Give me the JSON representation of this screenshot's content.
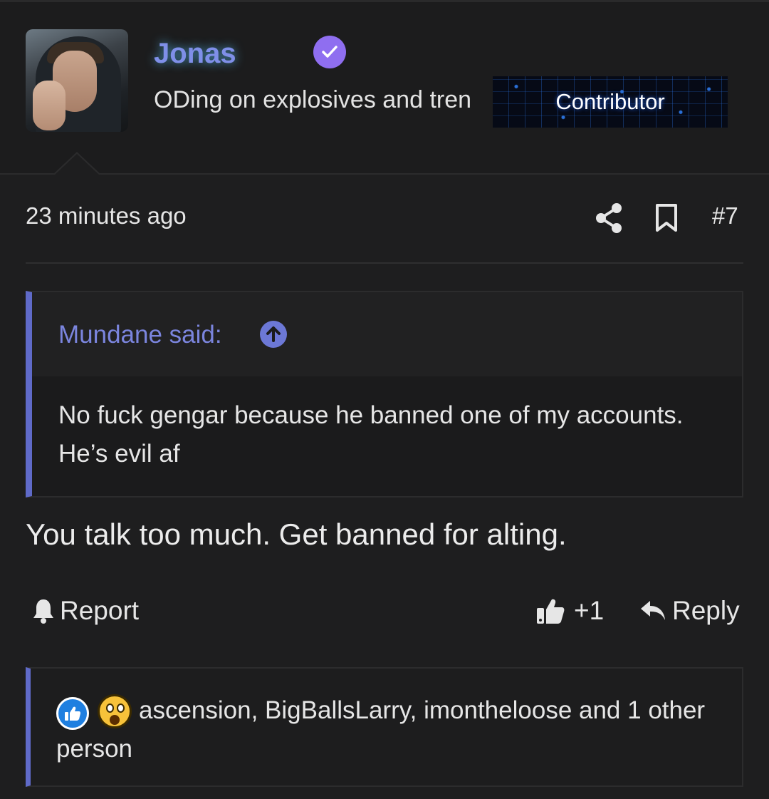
{
  "post": {
    "author": {
      "name": "Jonas",
      "title": "ODing on explosives and tren",
      "banner": "Contributor"
    },
    "timestamp": "23 minutes ago",
    "number": "#7",
    "quote": {
      "author_label": "Mundane said:",
      "text": "No fuck gengar because he banned one of my accounts. He’s evil af"
    },
    "message": "You talk too much. Get banned for alting.",
    "actions": {
      "report": "Report",
      "like_count": "+1",
      "reply": "Reply"
    },
    "reactions": {
      "icons": [
        "like-icon",
        "wow-icon"
      ],
      "text": "ascension, BigBallsLarry, imontheloose and 1 other person"
    }
  },
  "colors": {
    "background": "#1e1e1f",
    "username": "#7f8fe8",
    "verified_badge": "#8f6ef0",
    "quote_accent": "#5f6ac8",
    "like_reaction": "#1f7fe0"
  }
}
